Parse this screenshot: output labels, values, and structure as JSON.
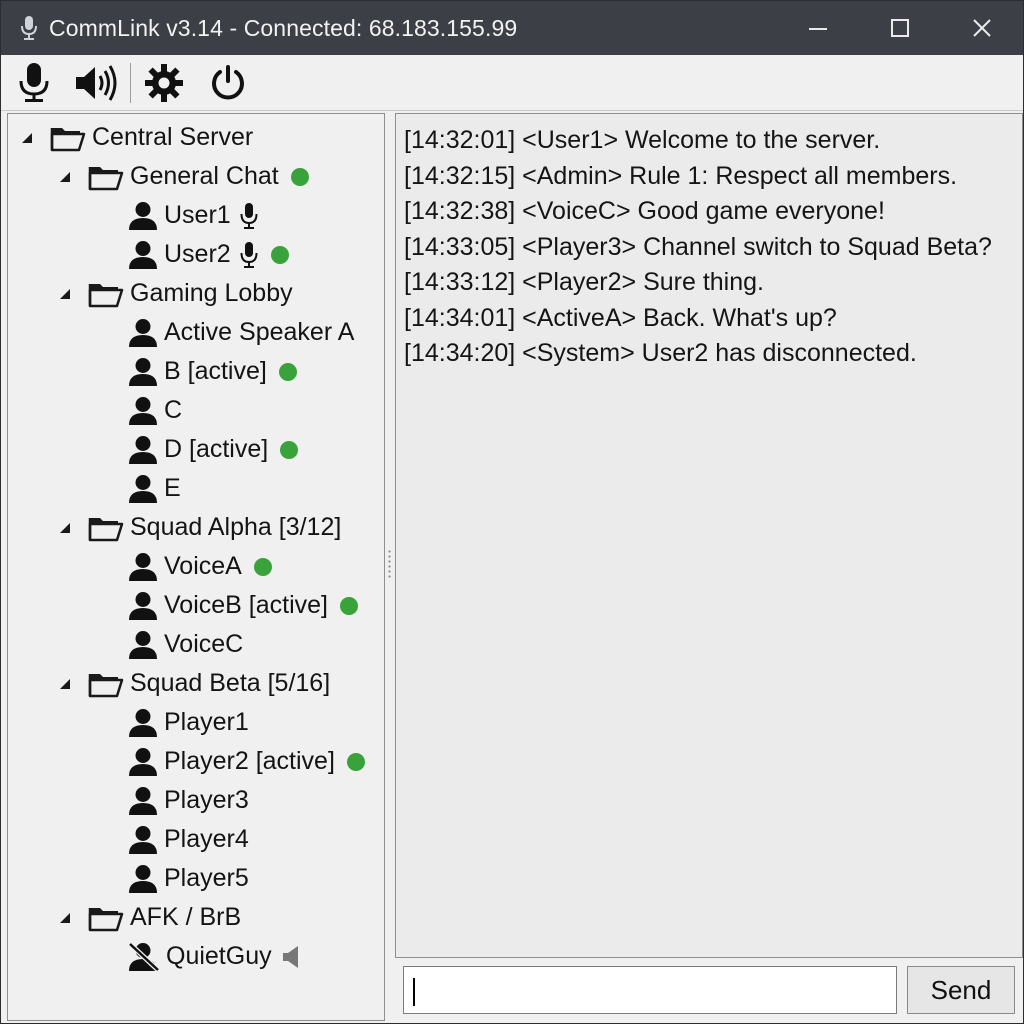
{
  "window": {
    "title": "CommLink v3.14 - Connected: 68.183.155.99"
  },
  "colors": {
    "titlebar": "#3c4046",
    "active_dot": "#3aa23a",
    "panel_bg": "#f0f0f0",
    "chat_bg": "#ebebeb"
  },
  "toolbar": {
    "icons": [
      "microphone-icon",
      "speaker-icon",
      "gear-icon",
      "power-icon"
    ]
  },
  "tree": {
    "server": "Central Server",
    "channels": [
      {
        "name": "General Chat",
        "active": true,
        "users": [
          {
            "name": "User1",
            "mic": true,
            "active": false
          },
          {
            "name": "User2",
            "mic": true,
            "active": true
          }
        ]
      },
      {
        "name": "Gaming Lobby",
        "active": false,
        "users": [
          {
            "name": "Active Speaker A",
            "active": false
          },
          {
            "name": "B [active]",
            "active": true
          },
          {
            "name": "C",
            "active": false
          },
          {
            "name": "D [active]",
            "active": true
          },
          {
            "name": "E",
            "active": false
          }
        ]
      },
      {
        "name": "Squad Alpha [3/12]",
        "active": false,
        "users": [
          {
            "name": "VoiceA",
            "active": true
          },
          {
            "name": "VoiceB [active]",
            "active": true
          },
          {
            "name": "VoiceC",
            "active": false
          }
        ]
      },
      {
        "name": "Squad Beta [5/16]",
        "active": false,
        "users": [
          {
            "name": "Player1",
            "active": false
          },
          {
            "name": "Player2 [active]",
            "active": true
          },
          {
            "name": "Player3",
            "active": false
          },
          {
            "name": "Player4",
            "active": false
          },
          {
            "name": "Player5",
            "active": false
          }
        ]
      },
      {
        "name": "AFK / BrB",
        "active": false,
        "users": [
          {
            "name": "QuietGuy",
            "muted": true,
            "active": false
          }
        ]
      }
    ]
  },
  "chat": {
    "messages": [
      "[14:32:01] <User1> Welcome to the server.",
      "[14:32:15] <Admin> Rule 1: Respect all members.",
      "[14:32:38] <VoiceC> Good game everyone!",
      "[14:33:05] <Player3> Channel switch to Squad Beta?",
      "[14:33:12] <Player2> Sure thing.",
      "[14:34:01] <ActiveA> Back. What's up?",
      "[14:34:20] <System> User2 has disconnected."
    ],
    "input_value": "",
    "send_label": "Send"
  }
}
